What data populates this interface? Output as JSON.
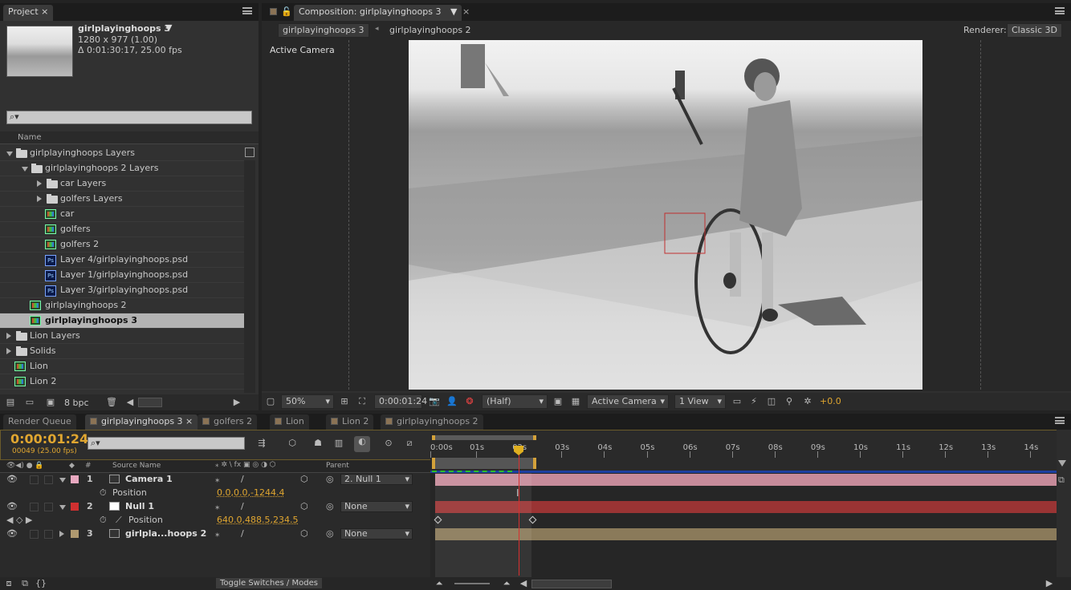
{
  "project": {
    "tab": "Project",
    "item_name": "girlplayinghoops 3",
    "item_size": "1280 x 977 (1.00)",
    "item_duration": "Δ 0:01:30:17, 25.00 fps",
    "search_placeholder": "",
    "col_name": "Name",
    "bpc": "8 bpc",
    "items": [
      {
        "label": "girlplayinghoops Layers",
        "type": "folder",
        "indent": 0,
        "tri": "down"
      },
      {
        "label": "girlplayinghoops 2 Layers",
        "type": "folder",
        "indent": 1,
        "tri": "down"
      },
      {
        "label": "car Layers",
        "type": "folder",
        "indent": 2,
        "tri": "right"
      },
      {
        "label": "golfers Layers",
        "type": "folder",
        "indent": 2,
        "tri": "right"
      },
      {
        "label": "car",
        "type": "comp",
        "indent": 2,
        "tri": ""
      },
      {
        "label": "golfers",
        "type": "comp",
        "indent": 2,
        "tri": ""
      },
      {
        "label": "golfers 2",
        "type": "comp",
        "indent": 2,
        "tri": ""
      },
      {
        "label": "Layer 4/girlplayinghoops.psd",
        "type": "psd",
        "indent": 2,
        "tri": ""
      },
      {
        "label": "Layer 1/girlplayinghoops.psd",
        "type": "psd",
        "indent": 2,
        "tri": ""
      },
      {
        "label": "Layer 3/girlplayinghoops.psd",
        "type": "psd",
        "indent": 2,
        "tri": ""
      },
      {
        "label": "girlplayinghoops 2",
        "type": "comp",
        "indent": 1,
        "tri": ""
      },
      {
        "label": "girlplayinghoops 3",
        "type": "comp",
        "indent": 1,
        "tri": "",
        "selected": true
      },
      {
        "label": "Lion Layers",
        "type": "folder",
        "indent": 0,
        "tri": "right"
      },
      {
        "label": "Solids",
        "type": "folder",
        "indent": 0,
        "tri": "right"
      },
      {
        "label": "Lion",
        "type": "comp",
        "indent": 0,
        "tri": ""
      },
      {
        "label": "Lion 2",
        "type": "comp",
        "indent": 0,
        "tri": ""
      }
    ]
  },
  "composition": {
    "tab": "Composition: girlplayinghoops 3",
    "crumb1": "girlplayinghoops 3",
    "crumb2": "girlplayinghoops 2",
    "renderer_label": "Renderer:",
    "renderer_value": "Classic 3D",
    "view_label": "Active Camera",
    "zoom": "50%",
    "timecode": "0:00:01:24",
    "resolution": "(Half)",
    "camera": "Active Camera",
    "views": "1 View",
    "exposure": "+0.0"
  },
  "timeline": {
    "tabs": [
      "Render Queue",
      "girlplayinghoops 3",
      "golfers 2",
      "Lion",
      "Lion 2",
      "girlplayinghoops 2"
    ],
    "timecode": "0:00:01:24",
    "frames": "00049 (25.00 fps)",
    "col_source": "Source Name",
    "col_parent": "Parent",
    "col_num": "#",
    "ruler": [
      "0:00s",
      "01s",
      "02s",
      "03s",
      "04s",
      "05s",
      "06s",
      "07s",
      "08s",
      "09s",
      "10s",
      "11s",
      "12s",
      "13s",
      "14s"
    ],
    "layers": [
      {
        "num": "1",
        "name": "Camera 1",
        "parent": "2. Null 1",
        "color": "#e8a8c0",
        "bar": "#c68b9a"
      },
      {
        "prop": "Position",
        "value": "0.0,0.0,-1244.4"
      },
      {
        "num": "2",
        "name": "Null 1",
        "parent": "None",
        "color": "#d03030",
        "bar": "#9a3434"
      },
      {
        "prop": "Position",
        "value": "640.0,488.5,234.5"
      },
      {
        "num": "3",
        "name": "girlpla...hoops 2",
        "parent": "None",
        "color": "#b09a70",
        "bar": "#8a7a5a"
      }
    ],
    "toggle": "Toggle Switches / Modes"
  }
}
